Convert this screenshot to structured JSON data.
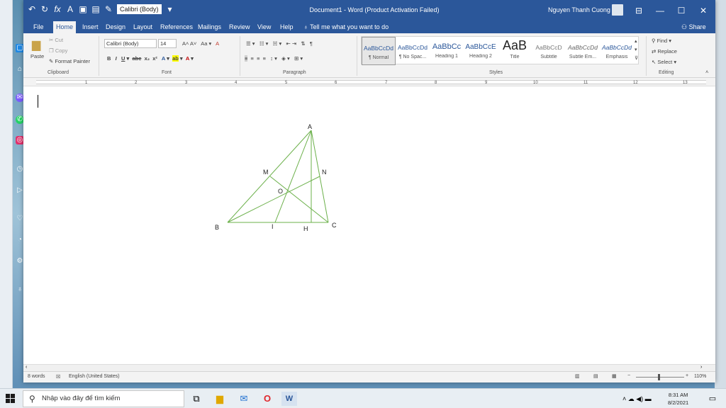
{
  "window": {
    "title": "Document1  -  Word (Product Activation Failed)",
    "user": "Nguyen Thanh Cuong",
    "qat_font": "Calibri (Body)"
  },
  "tabs": [
    "File",
    "Home",
    "Insert",
    "Design",
    "Layout",
    "References",
    "Mailings",
    "Review",
    "View",
    "Help"
  ],
  "tell_me": "Tell me what you want to do",
  "share": "Share",
  "ribbon": {
    "clipboard": {
      "paste": "Paste",
      "cut": "Cut",
      "copy": "Copy",
      "format_painter": "Format Painter",
      "label": "Clipboard"
    },
    "font": {
      "name": "Calibri (Body)",
      "size": "14",
      "label": "Font"
    },
    "paragraph": {
      "label": "Paragraph"
    },
    "styles": {
      "label": "Styles",
      "items": [
        {
          "sample": "AaBbCcDd",
          "name": "¶ Normal"
        },
        {
          "sample": "AaBbCcDd",
          "name": "¶ No Spac..."
        },
        {
          "sample": "AaBbCc",
          "name": "Heading 1"
        },
        {
          "sample": "AaBbCcE",
          "name": "Heading 2"
        },
        {
          "sample": "AaB",
          "name": "Title"
        },
        {
          "sample": "AaBbCcD",
          "name": "Subtitle"
        },
        {
          "sample": "AaBbCcDd",
          "name": "Subtle Em..."
        },
        {
          "sample": "AaBbCcDd",
          "name": "Emphasis"
        }
      ]
    },
    "editing": {
      "find": "Find",
      "replace": "Replace",
      "select": "Select",
      "label": "Editing"
    }
  },
  "ruler": [
    "1",
    "2",
    "3",
    "4",
    "5",
    "6",
    "7",
    "8",
    "9",
    "10",
    "11",
    "12",
    "13"
  ],
  "figure": {
    "labels": {
      "A": "A",
      "B": "B",
      "C": "C",
      "M": "M",
      "N": "N",
      "O": "O",
      "I": "I",
      "H": "H"
    },
    "line_color": "#6bb04a"
  },
  "status": {
    "words": "8 words",
    "language": "English (United States)",
    "zoom": "110%"
  },
  "taskbar": {
    "search_placeholder": "Nhập vào đây để tìm kiếm",
    "time": "8:31 AM",
    "date": "8/2/2021"
  }
}
